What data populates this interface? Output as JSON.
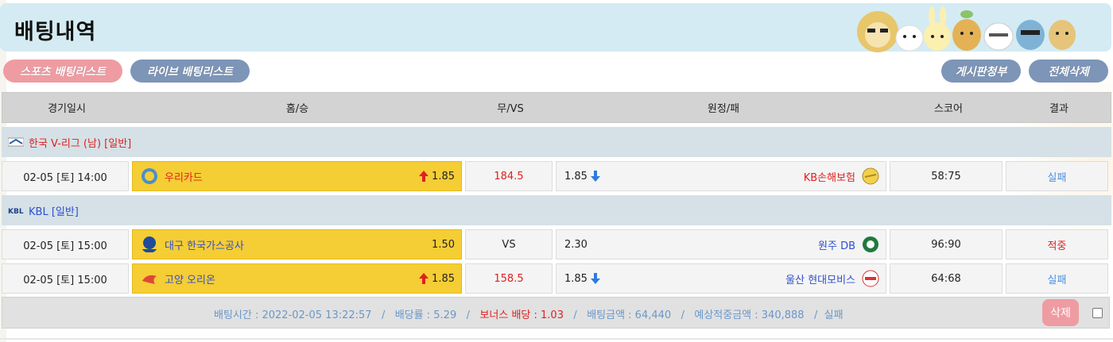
{
  "page": {
    "title": "배팅내역"
  },
  "buttons": {
    "sports_list": "스포츠 배팅리스트",
    "live_list": "라이브 배팅리스트",
    "board_request": "게시판청부",
    "delete_all": "전체삭제"
  },
  "columns": [
    "경기일시",
    "홈/승",
    "무/VS",
    "원정/패",
    "스코어",
    "결과"
  ],
  "leagues": [
    {
      "name": "한국 V-리그 (남) [일반]",
      "name_color": "#e02020",
      "games": [
        {
          "datetime": "02-05 [토] 14:00",
          "home": "우리카드",
          "home_odd": "1.85",
          "home_arrow": "up",
          "draw": "184.5",
          "draw_color": "#e02020",
          "away_odd": "1.85",
          "away_arrow": "down",
          "away": "KB손해보험",
          "score": "58:75",
          "result": "실패",
          "result_color": "#4a90e2"
        }
      ]
    },
    {
      "name": "KBL [일반]",
      "name_color": "#2f4fd0",
      "games": [
        {
          "datetime": "02-05 [토] 15:00",
          "home": "대구 한국가스공사",
          "home_odd": "1.50",
          "home_arrow": "",
          "draw": "VS",
          "draw_color": "#222222",
          "away_odd": "2.30",
          "away_arrow": "",
          "away": "원주 DB",
          "score": "96:90",
          "result": "적중",
          "result_color": "#e02020"
        },
        {
          "datetime": "02-05 [토] 15:00",
          "home": "고양 오리온",
          "home_odd": "1.85",
          "home_arrow": "up",
          "draw": "158.5",
          "draw_color": "#e02020",
          "away_odd": "1.85",
          "away_arrow": "down",
          "away": "울산 현대모비스",
          "score": "64:68",
          "result": "실패",
          "result_color": "#4a90e2"
        }
      ]
    }
  ],
  "summary": {
    "bet_time": "배팅시간 : 2022-02-05 13:22:57",
    "odds": "배당률 : 5.29",
    "bonus": "보너스 배당 : 1.03",
    "bet_amount": "배팅금액 : 64,440",
    "expected": "예상적중금액 : 340,888",
    "status": "실패",
    "separator": "/",
    "delete_label": "삭제"
  },
  "colors": {
    "accent_pink": "#ee9ca2",
    "accent_blue": "#7d95b7",
    "home_yellow": "#f5cd35"
  }
}
